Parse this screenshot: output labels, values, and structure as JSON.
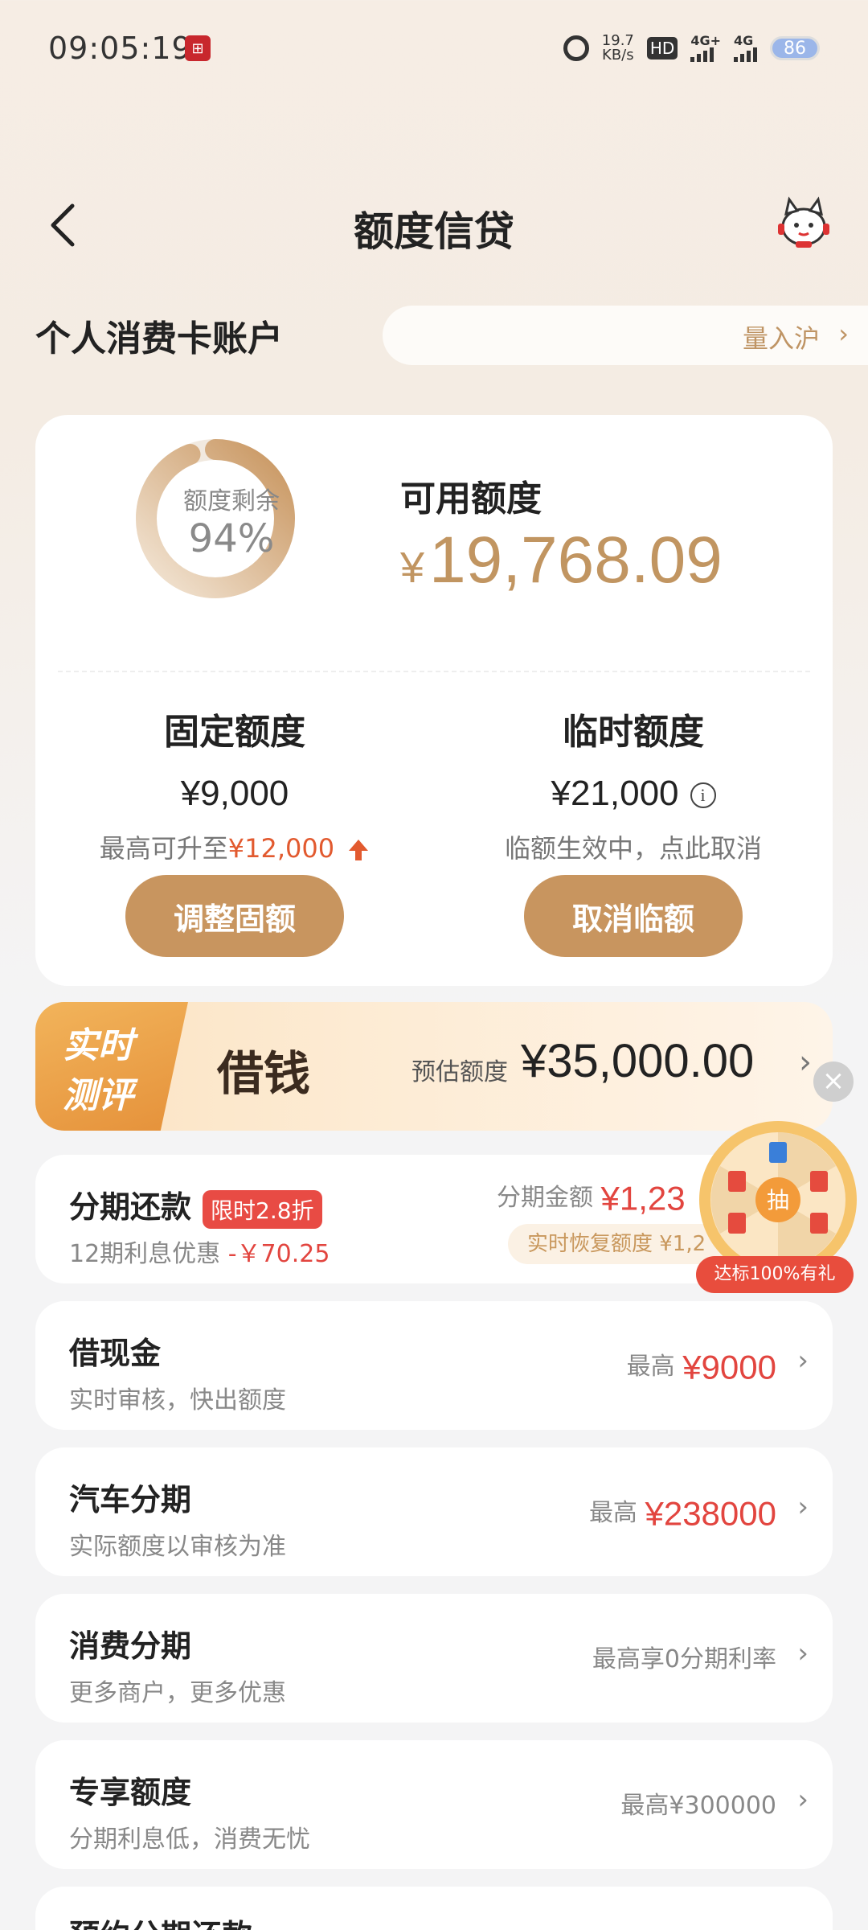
{
  "status_bar": {
    "time": "09:05:19",
    "net_speed_value": "19.7",
    "net_speed_unit": "KB/s",
    "hd_label": "HD",
    "sim1_label": "4G+",
    "sim2_label": "4G",
    "battery": "86"
  },
  "header": {
    "title": "额度信贷"
  },
  "account": {
    "title": "个人消费卡账户",
    "marquee_text": "量入沪"
  },
  "credit": {
    "ring_label": "额度剩余",
    "ring_percent": "94%",
    "ring_fraction": 0.94,
    "available_label": "可用额度",
    "available_currency": "¥",
    "available_amount": "19,768.09",
    "fixed_title": "固定额度",
    "fixed_amount": "¥9,000",
    "fixed_sub_prefix": "最高可升至",
    "fixed_sub_highlight": "¥12,000",
    "temp_title": "临时额度",
    "temp_amount": "¥21,000",
    "temp_sub": "临额生效中，点此取消",
    "adjust_button": "调整固额",
    "cancel_button": "取消临额"
  },
  "loan_banner": {
    "tag_line1": "实时",
    "tag_line2": "测评",
    "title": "借钱",
    "estimate_label": "预估额度",
    "estimate_amount": "¥35,000.00"
  },
  "wheel": {
    "center_label": "抽",
    "badge": "达标100%有礼"
  },
  "installment": {
    "title": "分期还款",
    "tag": "限时2.8折",
    "sub_prefix": "12期利息优惠",
    "sub_discount": "-￥70.25",
    "amount_label": "分期金额",
    "amount_value": "¥1,23",
    "restore_text": "实时恢复额度 ¥1,2"
  },
  "list": [
    {
      "title": "借现金",
      "subtitle": "实时审核，快出额度",
      "right_prefix": "最高",
      "right_value": "¥9000"
    },
    {
      "title": "汽车分期",
      "subtitle": "实际额度以审核为准",
      "right_prefix": "最高",
      "right_value": "¥238000"
    },
    {
      "title": "消费分期",
      "subtitle": "更多商户，更多优惠",
      "right_text": "最高享0分期利率"
    },
    {
      "title": "专享额度",
      "subtitle": "分期利息低，消费无忧",
      "right_text": "最高¥300000"
    },
    {
      "title": "预约分期还款"
    }
  ],
  "colors": {
    "gold": "#c8955f",
    "gold_text": "#c19561",
    "accent_red": "#e2453f",
    "orange_red": "#e25a2f"
  }
}
